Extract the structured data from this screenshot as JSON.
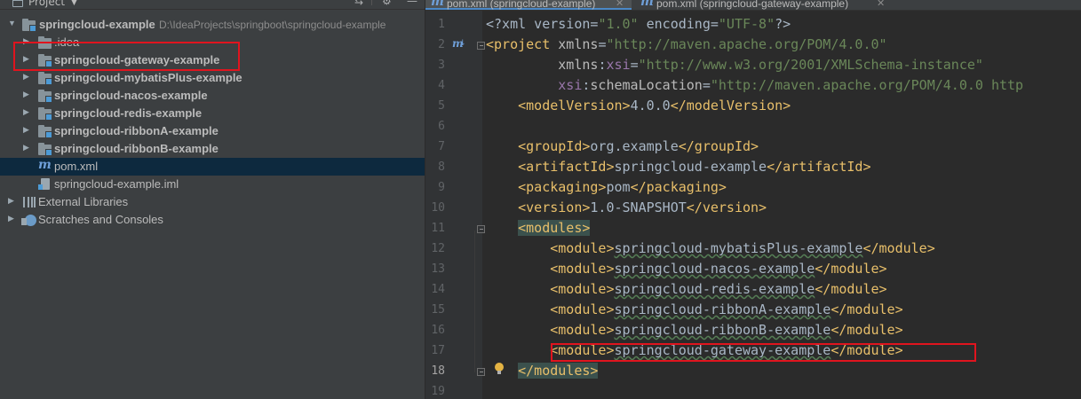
{
  "colors": {
    "accent_red": "#e0141e",
    "selection": "#0d293e",
    "xml_tag": "#e8bf6a",
    "xml_value": "#6a8759",
    "xml_namespace": "#9876aa",
    "editor_bg": "#2b2b2b",
    "panel_bg": "#3c3f41"
  },
  "project_panel": {
    "title": "Project",
    "tree": [
      {
        "label": "springcloud-example",
        "path": "D:\\IdeaProjects\\springboot\\springcloud-example",
        "icon": "module-folder-icon"
      },
      {
        "label": ".idea",
        "icon": "folder-icon"
      },
      {
        "label": "springcloud-gateway-example",
        "icon": "module-folder-icon"
      },
      {
        "label": "springcloud-mybatisPlus-example",
        "icon": "module-folder-icon"
      },
      {
        "label": "springcloud-nacos-example",
        "icon": "module-folder-icon"
      },
      {
        "label": "springcloud-redis-example",
        "icon": "module-folder-icon"
      },
      {
        "label": "springcloud-ribbonA-example",
        "icon": "module-folder-icon"
      },
      {
        "label": "springcloud-ribbonB-example",
        "icon": "module-folder-icon"
      },
      {
        "label": "pom.xml",
        "icon": "maven-file-icon",
        "selected": true
      },
      {
        "label": "springcloud-example.iml",
        "icon": "iml-file-icon"
      },
      {
        "label": "External Libraries",
        "icon": "library-icon"
      },
      {
        "label": "Scratches and Consoles",
        "icon": "scratches-icon"
      }
    ]
  },
  "editor": {
    "tabs": [
      {
        "label": "pom.xml (springcloud-example)",
        "active": true
      },
      {
        "label": "pom.xml (springcloud-gateway-example)",
        "active": false
      }
    ],
    "lines": [
      {
        "num": "1",
        "tokens": [
          [
            "<?xml version=",
            "c-text"
          ],
          [
            "\"1.0\"",
            "c-val"
          ],
          [
            " encoding=",
            "c-text"
          ],
          [
            "\"UTF-8\"",
            "c-val"
          ],
          [
            "?>",
            "c-text"
          ]
        ]
      },
      {
        "num": "2",
        "tokens": [
          [
            "<project ",
            "c-tag"
          ],
          [
            "xmlns",
            "c-attr"
          ],
          [
            "=",
            "c-text"
          ],
          [
            "\"http://maven.apache.org/POM/4.0.0\"",
            "c-val"
          ]
        ]
      },
      {
        "num": "3",
        "tokens": [
          [
            "         ",
            "c-text"
          ],
          [
            "xmlns",
            "c-attr"
          ],
          [
            ":",
            "c-text"
          ],
          [
            "xsi",
            "c-ns"
          ],
          [
            "=",
            "c-text"
          ],
          [
            "\"http://www.w3.org/2001/XMLSchema-instance\"",
            "c-val"
          ]
        ]
      },
      {
        "num": "4",
        "tokens": [
          [
            "         ",
            "c-text"
          ],
          [
            "xsi",
            "c-ns"
          ],
          [
            ":",
            "c-text"
          ],
          [
            "schemaLocation",
            "c-attr"
          ],
          [
            "=",
            "c-text"
          ],
          [
            "\"http://maven.apache.org/POM/4.0.0 http",
            "c-val"
          ]
        ]
      },
      {
        "num": "5",
        "tokens": [
          [
            "    ",
            "c-text"
          ],
          [
            "<modelVersion>",
            "c-tag"
          ],
          [
            "4.0.0",
            "c-text"
          ],
          [
            "</modelVersion>",
            "c-tag"
          ]
        ]
      },
      {
        "num": "6",
        "tokens": []
      },
      {
        "num": "7",
        "tokens": [
          [
            "    ",
            "c-text"
          ],
          [
            "<groupId>",
            "c-tag"
          ],
          [
            "org.example",
            "c-text"
          ],
          [
            "</groupId>",
            "c-tag"
          ]
        ]
      },
      {
        "num": "8",
        "tokens": [
          [
            "    ",
            "c-text"
          ],
          [
            "<artifactId>",
            "c-tag"
          ],
          [
            "springcloud-example",
            "c-text"
          ],
          [
            "</artifactId>",
            "c-tag"
          ]
        ]
      },
      {
        "num": "9",
        "tokens": [
          [
            "    ",
            "c-text"
          ],
          [
            "<packaging>",
            "c-tag"
          ],
          [
            "pom",
            "c-text"
          ],
          [
            "</packaging>",
            "c-tag"
          ]
        ]
      },
      {
        "num": "10",
        "tokens": [
          [
            "    ",
            "c-text"
          ],
          [
            "<version>",
            "c-tag"
          ],
          [
            "1.0-SNAPSHOT",
            "c-text"
          ],
          [
            "</version>",
            "c-tag"
          ]
        ]
      },
      {
        "num": "11",
        "tokens": [
          [
            "    ",
            "c-text"
          ],
          [
            "<modules>",
            "c-tag tag-hl"
          ]
        ]
      },
      {
        "num": "12",
        "tokens": [
          [
            "        ",
            "c-text"
          ],
          [
            "<module>",
            "c-tag"
          ],
          [
            "springcloud-mybatisPlus-example",
            "c-text c-squig"
          ],
          [
            "</module>",
            "c-tag"
          ]
        ]
      },
      {
        "num": "13",
        "tokens": [
          [
            "        ",
            "c-text"
          ],
          [
            "<module>",
            "c-tag"
          ],
          [
            "springcloud-nacos-example",
            "c-text c-squig"
          ],
          [
            "</module>",
            "c-tag"
          ]
        ]
      },
      {
        "num": "14",
        "tokens": [
          [
            "        ",
            "c-text"
          ],
          [
            "<module>",
            "c-tag"
          ],
          [
            "springcloud-redis-example",
            "c-text c-squig"
          ],
          [
            "</module>",
            "c-tag"
          ]
        ]
      },
      {
        "num": "15",
        "tokens": [
          [
            "        ",
            "c-text"
          ],
          [
            "<module>",
            "c-tag"
          ],
          [
            "springcloud-ribbonA-example",
            "c-text c-squig"
          ],
          [
            "</module>",
            "c-tag"
          ]
        ]
      },
      {
        "num": "16",
        "tokens": [
          [
            "        ",
            "c-text"
          ],
          [
            "<module>",
            "c-tag"
          ],
          [
            "springcloud-ribbonB-example",
            "c-text c-squig"
          ],
          [
            "</module>",
            "c-tag"
          ]
        ]
      },
      {
        "num": "17",
        "tokens": [
          [
            "        ",
            "c-text"
          ],
          [
            "<module>",
            "c-tag"
          ],
          [
            "springcloud-gateway-example",
            "c-text c-squig"
          ],
          [
            "</module>",
            "c-tag"
          ]
        ]
      },
      {
        "num": "18",
        "tokens": [
          [
            "    ",
            "c-text"
          ],
          [
            "</modules>",
            "c-tag tag-hl"
          ]
        ],
        "current": true
      },
      {
        "num": "19",
        "tokens": []
      }
    ]
  }
}
